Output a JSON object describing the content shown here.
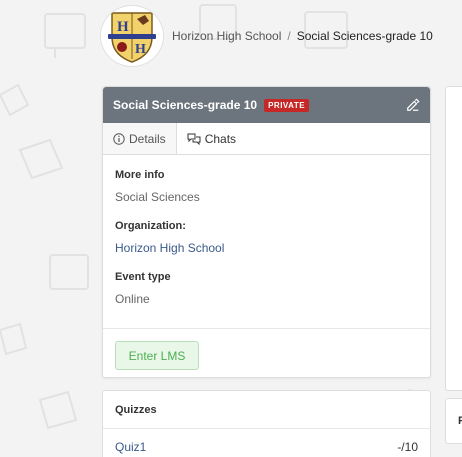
{
  "breadcrumb": {
    "school": "Horizon High School",
    "separator": "/",
    "current": "Social Sciences-grade 10"
  },
  "logo": {
    "alt_text": "HORIZON HIGH SCHOOL",
    "letters": [
      "H",
      "H"
    ]
  },
  "card": {
    "title": "Social Sciences-grade 10",
    "badge": "PRIVATE",
    "header_color": "#6c757d",
    "tabs": [
      {
        "label": "Details",
        "icon": "info-icon",
        "active": true
      },
      {
        "label": "Chats",
        "icon": "chat-icon",
        "active": false
      }
    ],
    "fields": {
      "more_info_label": "More info",
      "more_info_value": "Social Sciences",
      "organization_label": "Organization:",
      "organization_value": "Horizon High School",
      "event_type_label": "Event type",
      "event_type_value": "Online"
    },
    "enter_lms": "Enter LMS"
  },
  "quizzes": {
    "title": "Quizzes",
    "items": [
      {
        "name": "Quiz1",
        "score": "-/10"
      }
    ]
  },
  "side_panel": {
    "partial_label": "F"
  },
  "colors": {
    "badge_red": "#c62828",
    "link_blue": "#3a5a8c",
    "lms_green": "#4caf50"
  }
}
